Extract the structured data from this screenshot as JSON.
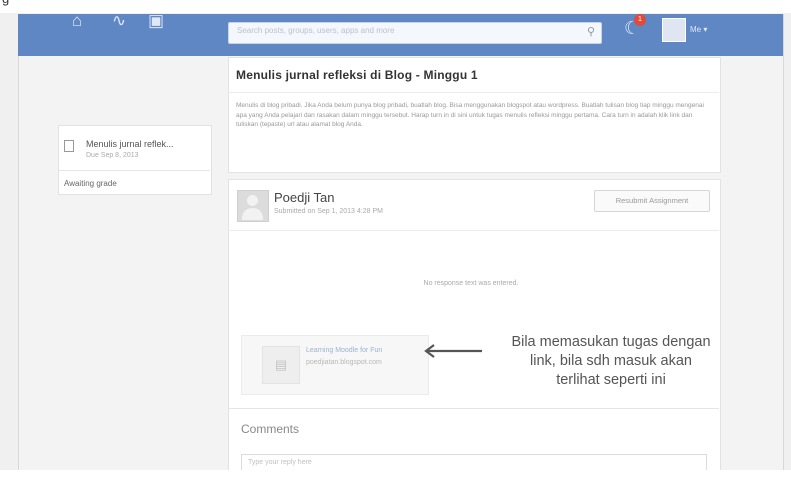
{
  "caption_fragment": "g",
  "navbar": {
    "search_placeholder": "Search posts, groups, users, apps and more",
    "notification_count": "1",
    "username": "Me"
  },
  "sidebar": {
    "assignment_title": "Menulis jurnal reflek...",
    "assignment_date": "Due Sep 8, 2013",
    "status": "Awaiting grade"
  },
  "assignment": {
    "title": "Menulis jurnal refleksi di Blog - Minggu 1",
    "body": "Menulis di blog pribadi. Jika Anda belum punya blog pribadi, buatlah blog. Bisa menggunakan blogspot atau wordpress. Buatlah tulisan blog tiap minggu mengenai apa yang Anda pelajari dan rasakan dalam minggu tersebut. Harap turn in di sini untuk tugas menulis refleksi minggu pertama. Cara turn in adalah klik link dan tuliskan (tepaste) url atau alamat blog Anda."
  },
  "submission": {
    "student_name": "Poedji Tan",
    "submitted_at": "Submitted on Sep 1, 2013 4:28 PM",
    "resubmit_label": "Resubmit Assignment",
    "no_response": "No response text was entered.",
    "link_title": "Learning Moodle for Fun",
    "link_url": "poedjiatan.blogspot.com"
  },
  "annotation": {
    "line1": "Bila memasukan tugas dengan",
    "line2": "link, bila sdh masuk akan",
    "line3": "terlihat seperti ini"
  },
  "comments": {
    "label": "Comments",
    "placeholder": "Type your reply here"
  },
  "colors": {
    "navbar": "#5f87c4",
    "badge": "#e04b3c"
  }
}
